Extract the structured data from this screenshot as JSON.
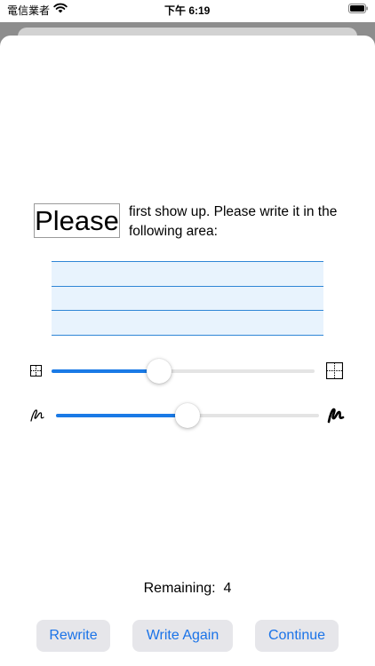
{
  "status_bar": {
    "carrier": "電信業者",
    "time": "下午 6:19"
  },
  "prompt": {
    "word": "Please",
    "instruction": "first show up. Please write it in the following area:"
  },
  "size_slider": {
    "value_fraction": 0.41,
    "min_icon": "small-grid-icon",
    "max_icon": "large-grid-icon"
  },
  "stroke_slider": {
    "value_fraction": 0.5,
    "min_icon": "thin-pen-icon",
    "max_icon": "thick-pen-icon"
  },
  "remaining": {
    "label": "Remaining:",
    "count": "4"
  },
  "buttons": {
    "rewrite": "Rewrite",
    "write_again": "Write Again",
    "continue": "Continue"
  },
  "colors": {
    "accent": "#1a7ae6",
    "writing_area": "#e8f3fd",
    "guide_line": "#2f86d6",
    "button_bg": "#e6e6ea"
  }
}
